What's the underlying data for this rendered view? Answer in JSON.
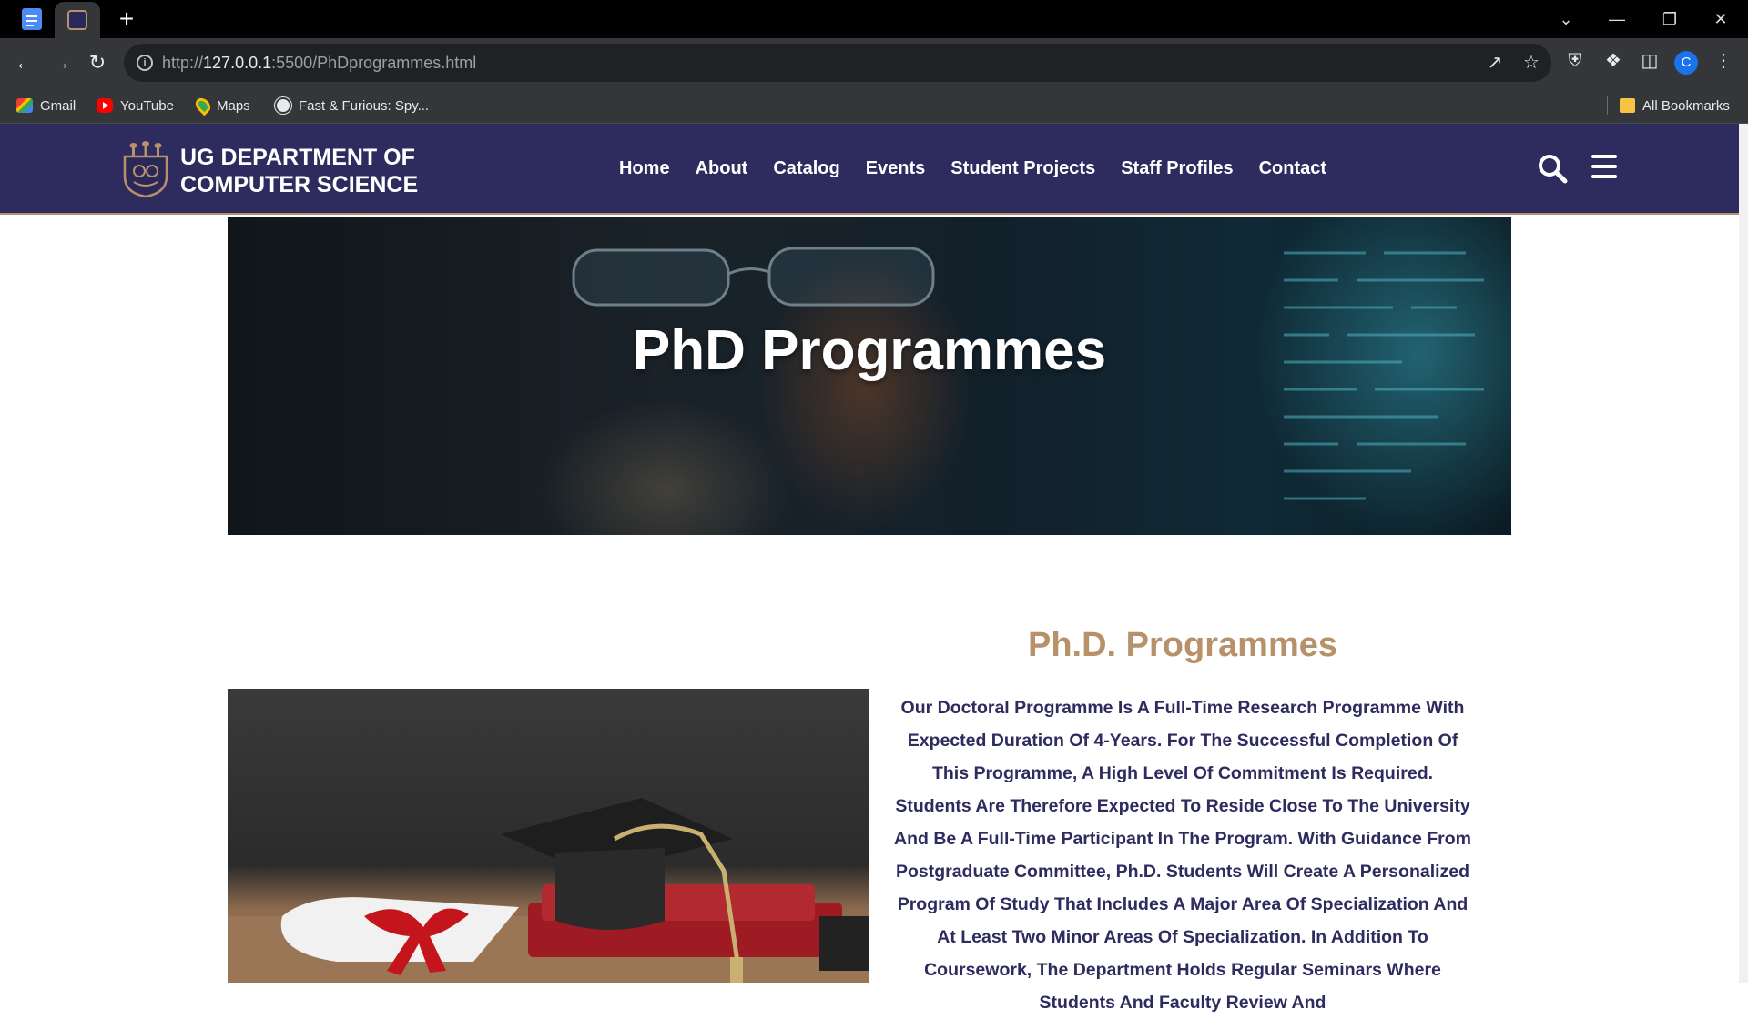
{
  "browser": {
    "url_scheme": "http://",
    "url_host": "127.0.0.1",
    "url_path": ":5500/PhDprogrammes.html",
    "bookmarks": [
      {
        "label": "Gmail",
        "icon": "gmail-icon"
      },
      {
        "label": "YouTube",
        "icon": "youtube-icon"
      },
      {
        "label": "Maps",
        "icon": "maps-icon"
      },
      {
        "label": "Fast & Furious: Spy...",
        "icon": "globe-icon"
      }
    ],
    "all_bookmarks": "All Bookmarks",
    "profile_initial": "C"
  },
  "site": {
    "title_line1": "UG DEPARTMENT OF",
    "title_line2": "COMPUTER SCIENCE",
    "nav": [
      "Home",
      "About",
      "Catalog",
      "Events",
      "Student Projects",
      "Staff Profiles",
      "Contact"
    ],
    "colors": {
      "primary": "#2e2b5f",
      "accent": "#b6916a"
    }
  },
  "hero": {
    "title": "PhD Programmes"
  },
  "content": {
    "heading": "Ph.D. Programmes",
    "body": "Our Doctoral Programme Is A Full-Time Research Programme With Expected Duration Of 4-Years. For The Successful Completion Of This Programme, A High Level Of Commitment Is Required. Students Are Therefore Expected To Reside Close To The University And Be A Full-Time Participant In The Program. With Guidance From Postgraduate Committee, Ph.D. Students Will Create A Personalized Program Of Study That Includes A Major Area Of Specialization And At Least Two Minor Areas Of Specialization. In Addition To Coursework, The Department Holds Regular Seminars Where Students And Faculty Review And"
  }
}
